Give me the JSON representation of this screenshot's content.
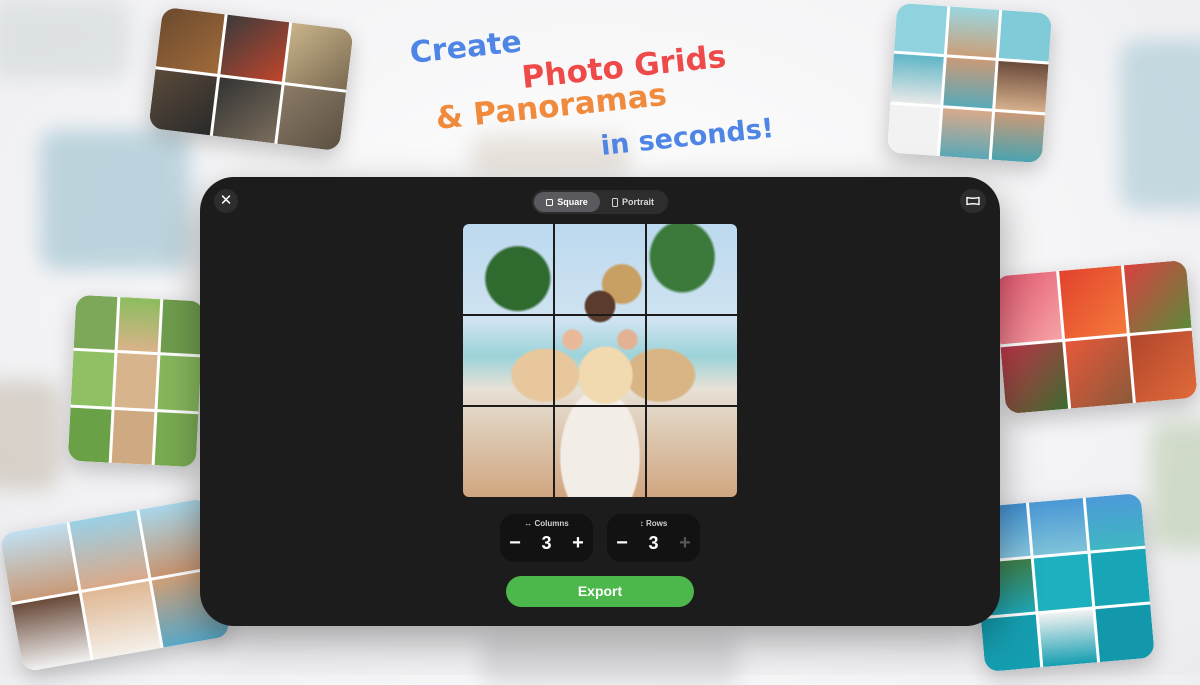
{
  "headline": {
    "line1": "Create",
    "line2": "Photo Grids",
    "line3": "& Panoramas",
    "line4": "in seconds!",
    "colors": {
      "line1": "#4f86e6",
      "line2": "#ef4a4a",
      "line3": "#f08a3c",
      "line4": "#4f86e6"
    }
  },
  "editor": {
    "close_icon": "close-icon",
    "aspect_options": [
      {
        "label": "Square",
        "icon": "square-icon",
        "active": true
      },
      {
        "label": "Portrait",
        "icon": "portrait-icon",
        "active": false
      }
    ],
    "panorama_icon": "panorama-icon",
    "columns": {
      "label": "↔ Columns",
      "value": "3",
      "minus": "−",
      "plus": "+"
    },
    "rows": {
      "label": "↕ Rows",
      "value": "3",
      "minus": "−",
      "plus": "+"
    },
    "export_label": "Export"
  },
  "colors": {
    "window_bg": "#1c1c1c",
    "export_green": "#4cb84c",
    "segment_active": "#5a5a5e"
  }
}
